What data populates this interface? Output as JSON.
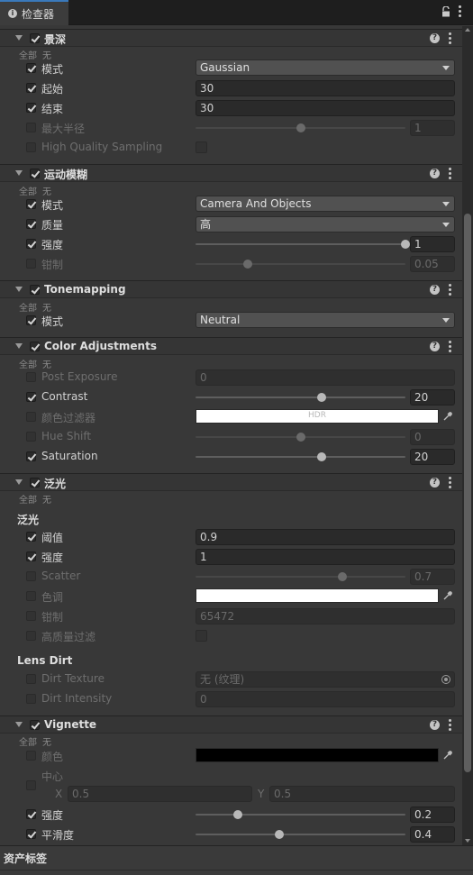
{
  "window": {
    "tab_title": "检查器"
  },
  "common": {
    "all": "全部",
    "none": "无"
  },
  "depth_of_field": {
    "title": "景深",
    "mode_label": "模式",
    "mode_value": "Gaussian",
    "start_label": "起始",
    "start_value": "30",
    "end_label": "结束",
    "end_value": "30",
    "max_radius_label": "最大半径",
    "max_radius_value": "1",
    "max_radius_fraction": 0.5,
    "hq_label": "High Quality Sampling"
  },
  "motion_blur": {
    "title": "运动模糊",
    "mode_label": "模式",
    "mode_value": "Camera And Objects",
    "quality_label": "质量",
    "quality_value": "高",
    "intensity_label": "强度",
    "intensity_value": "1",
    "intensity_fraction": 1.0,
    "clamp_label": "钳制",
    "clamp_value": "0.05",
    "clamp_fraction": 0.25
  },
  "tonemapping": {
    "title": "Tonemapping",
    "mode_label": "模式",
    "mode_value": "Neutral"
  },
  "color_adjustments": {
    "title": "Color Adjustments",
    "post_exposure_label": "Post Exposure",
    "post_exposure_value": "0",
    "contrast_label": "Contrast",
    "contrast_value": "20",
    "contrast_fraction": 0.6,
    "color_filter_label": "颜色过滤器",
    "color_filter_hdr": "HDR",
    "color_filter_color": "#ffffff",
    "hue_shift_label": "Hue Shift",
    "hue_shift_value": "0",
    "hue_shift_fraction": 0.5,
    "saturation_label": "Saturation",
    "saturation_value": "20",
    "saturation_fraction": 0.6
  },
  "bloom": {
    "title": "泛光",
    "section_bloom": "泛光",
    "threshold_label": "阈值",
    "threshold_value": "0.9",
    "intensity_label": "强度",
    "intensity_value": "1",
    "scatter_label": "Scatter",
    "scatter_value": "0.7",
    "scatter_fraction": 0.7,
    "tint_label": "色调",
    "tint_color": "#ffffff",
    "clamp_label": "钳制",
    "clamp_value": "65472",
    "hq_label": "高质量过滤",
    "section_lens_dirt": "Lens Dirt",
    "dirt_texture_label": "Dirt Texture",
    "dirt_texture_value": "无 (纹理)",
    "dirt_intensity_label": "Dirt Intensity",
    "dirt_intensity_value": "0"
  },
  "vignette": {
    "title": "Vignette",
    "color_label": "颜色",
    "color_value": "#000000",
    "center_label": "中心",
    "center_x_label": "X",
    "center_x_value": "0.5",
    "center_y_label": "Y",
    "center_y_value": "0.5",
    "intensity_label": "强度",
    "intensity_value": "0.2",
    "intensity_fraction": 0.2,
    "smoothness_label": "平滑度",
    "smoothness_value": "0.4",
    "smoothness_fraction": 0.4
  },
  "footer": {
    "title": "资产标签"
  }
}
